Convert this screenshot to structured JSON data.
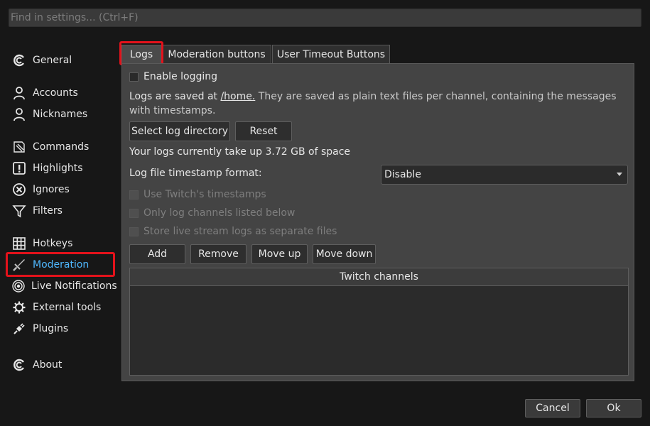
{
  "search": {
    "placeholder": "Find in settings... (Ctrl+F)"
  },
  "sidebar": {
    "items": [
      {
        "label": "General",
        "icon": "chatterino-logo-icon"
      },
      {
        "label": "Accounts",
        "icon": "user-icon"
      },
      {
        "label": "Nicknames",
        "icon": "user-icon"
      },
      {
        "label": "Commands",
        "icon": "commands-icon"
      },
      {
        "label": "Highlights",
        "icon": "exclamation-icon"
      },
      {
        "label": "Ignores",
        "icon": "x-circle-icon"
      },
      {
        "label": "Filters",
        "icon": "filter-icon"
      },
      {
        "label": "Hotkeys",
        "icon": "keyboard-grid-icon"
      },
      {
        "label": "Moderation",
        "icon": "sword-icon",
        "active": true
      },
      {
        "label": "Live Notifications",
        "icon": "radio-icon"
      },
      {
        "label": "External tools",
        "icon": "gear-icon"
      },
      {
        "label": "Plugins",
        "icon": "plug-icon"
      },
      {
        "label": "About",
        "icon": "chatterino-logo-icon"
      }
    ]
  },
  "tabs": [
    {
      "label": "Logs",
      "active": true
    },
    {
      "label": "Moderation buttons"
    },
    {
      "label": "User Timeout Buttons"
    }
  ],
  "logs": {
    "enable_logging": "Enable logging",
    "saved_prefix": "Logs are saved at ",
    "saved_path": "/home.",
    "saved_desc": " They are saved as plain text files per channel, containing the messages with timestamps.",
    "select_dir_button": "Select log directory",
    "reset_button": "Reset",
    "size_text": "Your logs currently take up 3.72 GB of space",
    "timestamp_label": "Log file timestamp format:",
    "timestamp_value": "Disable",
    "twitch_timestamps": "Use Twitch's timestamps",
    "only_listed": "Only log channels listed below",
    "separate_files": "Store live stream logs as separate files",
    "add_button": "Add",
    "remove_button": "Remove",
    "move_up_button": "Move up",
    "move_down_button": "Move down",
    "table_header": "Twitch channels"
  },
  "footer": {
    "cancel": "Cancel",
    "ok": "Ok"
  },
  "colors": {
    "accent": "#4fb8ff",
    "highlight": "#e3121b",
    "background": "#171717",
    "panel": "#444444"
  }
}
